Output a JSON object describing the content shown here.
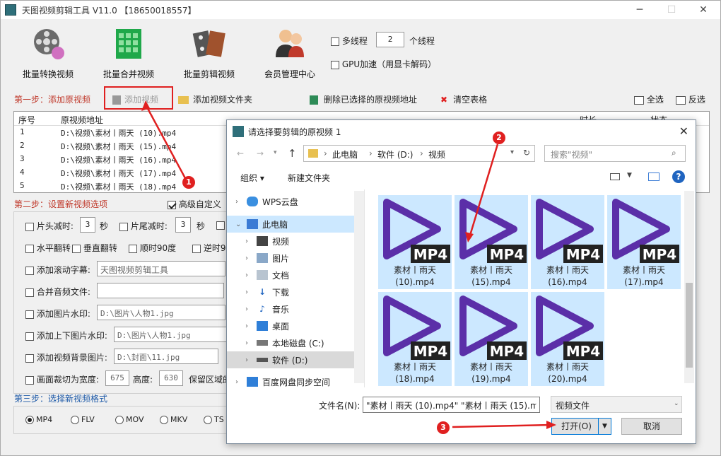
{
  "window": {
    "title": "天图视频剪辑工具 V11.0 【18650018557】"
  },
  "toolbar": [
    {
      "label": "批量转换视频",
      "icon": "film-reel-icon"
    },
    {
      "label": "批量合并视频",
      "icon": "green-grid-icon"
    },
    {
      "label": "批量剪辑视频",
      "icon": "film-strip-icon"
    },
    {
      "label": "会员管理中心",
      "icon": "users-icon"
    }
  ],
  "options": {
    "multithread_label": "多线程",
    "thread_count": "2",
    "thread_unit": "个线程",
    "gpu_label": "GPU加速（用显卡解码）"
  },
  "step1": {
    "label": "第一步：添加原视频",
    "add_video": "添加视频",
    "add_folder": "添加视频文件夹",
    "delete_selected": "删除已选择的原视频地址",
    "clear_table": "清空表格",
    "select_all": "全选",
    "invert": "反选"
  },
  "table": {
    "headers": [
      "序号",
      "原视频地址",
      "时长",
      "状态"
    ],
    "rows": [
      {
        "no": "1",
        "path": "D:\\视频\\素材丨雨天 (10).mp4"
      },
      {
        "no": "2",
        "path": "D:\\视频\\素材丨雨天 (15).mp4"
      },
      {
        "no": "3",
        "path": "D:\\视频\\素材丨雨天 (16).mp4"
      },
      {
        "no": "4",
        "path": "D:\\视频\\素材丨雨天 (17).mp4"
      },
      {
        "no": "5",
        "path": "D:\\视频\\素材丨雨天 (18).mp4"
      }
    ]
  },
  "step2": {
    "label": "第二步：设置新视频选项",
    "advanced": "高级自定义",
    "head_cut": "片头减时:",
    "head_val": "3",
    "sec": "秒",
    "tail_cut": "片尾减时:",
    "tail_val": "3",
    "sec2": "秒",
    "hflip": "水平翻转",
    "vflip": "垂直翻转",
    "cw90": "顺时90度",
    "ccw90": "逆时9",
    "subtitle": "添加滚动字幕:",
    "subtitle_val": "天图视频剪辑工具",
    "merge_audio": "合并音频文件:",
    "watermark": "添加图片水印:",
    "watermark_val": "D:\\图片\\人物1.jpg",
    "tb_image": "添加上下图片水印:",
    "tb_image_val": "D:\\图片\\人物1.jpg",
    "bg_image": "添加视频背景图片:",
    "bg_image_val": "D:\\封面\\11.jpg",
    "crop": "画面裁切为宽度:",
    "crop_w": "675",
    "crop_h_label": "高度:",
    "crop_h": "630",
    "keep_area": "保留区域的"
  },
  "step3": {
    "label": "第三步：选择新视频格式",
    "formats": [
      "MP4",
      "FLV",
      "MOV",
      "MKV",
      "TS"
    ],
    "selected": "MP4"
  },
  "dialog": {
    "title": "请选择要剪辑的原视频 1",
    "breadcrumb": [
      "此电脑",
      "软件 (D:)",
      "视频"
    ],
    "search_placeholder": "搜索\"视频\"",
    "organize": "组织 ▾",
    "new_folder": "新建文件夹",
    "nav": [
      {
        "label": "WPS云盘",
        "icon": "cloud-icon"
      },
      {
        "label": "此电脑",
        "icon": "computer-icon"
      },
      {
        "label": "视频",
        "icon": "video-folder-icon"
      },
      {
        "label": "图片",
        "icon": "picture-folder-icon"
      },
      {
        "label": "文档",
        "icon": "document-folder-icon"
      },
      {
        "label": "下载",
        "icon": "download-folder-icon"
      },
      {
        "label": "音乐",
        "icon": "music-folder-icon"
      },
      {
        "label": "桌面",
        "icon": "desktop-folder-icon"
      },
      {
        "label": "本地磁盘 (C:)",
        "icon": "drive-c-icon"
      },
      {
        "label": "软件 (D:)",
        "icon": "drive-d-icon"
      },
      {
        "label": "百度网盘同步空间",
        "icon": "baidu-icon"
      }
    ],
    "files": [
      {
        "name": "素材丨雨天",
        "ext": "(10).mp4"
      },
      {
        "name": "素材丨雨天",
        "ext": "(15).mp4"
      },
      {
        "name": "素材丨雨天",
        "ext": "(16).mp4"
      },
      {
        "name": "素材丨雨天",
        "ext": "(17).mp4"
      },
      {
        "name": "素材丨雨天",
        "ext": "(18).mp4"
      },
      {
        "name": "素材丨雨天",
        "ext": "(19).mp4"
      },
      {
        "name": "素材丨雨天",
        "ext": "(20).mp4"
      }
    ],
    "mp4_badge": "MP4",
    "filename_label": "文件名(N):",
    "filename_value": "\"素材丨雨天 (10).mp4\" \"素材丨雨天 (15).n",
    "filetype": "视频文件",
    "open": "打开(O)",
    "cancel": "取消"
  },
  "callouts": [
    "1",
    "2",
    "3"
  ],
  "colors": {
    "accent_red": "#e02020",
    "step_red": "#c0392b",
    "step_blue": "#1e5aa8",
    "tile_bg": "#cce8ff",
    "play_purple": "#5b2fa8"
  }
}
